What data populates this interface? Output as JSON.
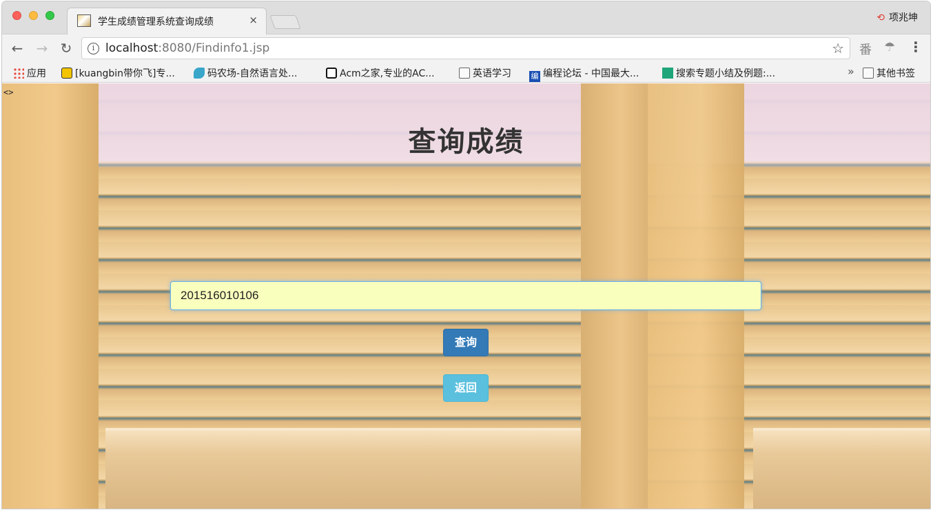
{
  "browser": {
    "tab_title": "学生成绩管理系统查询成绩",
    "tab_close": "×",
    "profile_name": "项兆坤",
    "url_host": "localhost",
    "url_rest": ":8080/Findinfo1.jsp",
    "bookmarks": [
      {
        "label": "应用",
        "icon": "apps-grid-icon"
      },
      {
        "label": "[kuangbin带你飞]专...",
        "icon": "smile-icon"
      },
      {
        "label": "码农场-自然语言处...",
        "icon": "bird-icon"
      },
      {
        "label": "Acm之家,专业的AC...",
        "icon": "acm-icon"
      },
      {
        "label": "英语学习",
        "icon": "folder-icon"
      },
      {
        "label": "编程论坛 - 中国最大...",
        "icon": "bian-icon"
      },
      {
        "label": "搜索专题小结及例题:...",
        "icon": "z-icon"
      },
      {
        "label": "其他书签",
        "icon": "folder-icon"
      }
    ],
    "bookmarks_more": "»",
    "bian_glyph": "编"
  },
  "page": {
    "corner_tag": "<>",
    "title": "查询成绩",
    "student_id_value": "201516010106",
    "query_button": "查询",
    "back_button": "返回"
  },
  "colors": {
    "query_button": "#337ab7",
    "back_button": "#5bc0de",
    "input_background": "#f9ffbd"
  }
}
